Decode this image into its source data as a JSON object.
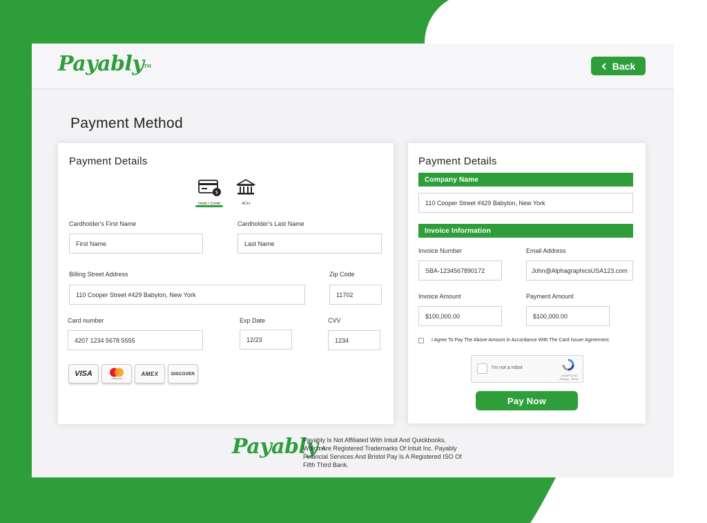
{
  "header": {
    "logo_text": "Payably",
    "logo_tm": "TM",
    "back_label": "Back"
  },
  "page_title": "Payment Method",
  "left_card": {
    "title": "Payment Details",
    "methods": [
      {
        "label": "Debit / Credit",
        "icon": "credit-card-icon",
        "selected": true
      },
      {
        "label": "ACH",
        "icon": "bank-icon",
        "selected": false
      }
    ],
    "fields": {
      "first_name": {
        "label": "Cardholder's First Name",
        "value": "First Name"
      },
      "last_name": {
        "label": "Cardholder's  Last Name",
        "value": "Last Name"
      },
      "street": {
        "label": "Billing Street Address",
        "value": "110 Cooper Street #429 Babylon, New York"
      },
      "zip": {
        "label": "Zip Code",
        "value": "11702"
      },
      "card_number": {
        "label": "Card number",
        "value": "4207 1234 5678 5555"
      },
      "exp_date": {
        "label": "Exp Date",
        "value": "12/23"
      },
      "cvv": {
        "label": "CVV",
        "value": "1234"
      }
    },
    "card_brands": [
      "VISA",
      "mastercard",
      "AMEX",
      "DISCOVER"
    ]
  },
  "right_card": {
    "title": "Payment Details",
    "company_section": "Company Name",
    "company_address": "110 Cooper Street #429 Babylon, New York",
    "invoice_section": "Invoice Information",
    "invoice_number": {
      "label": "Invoice Number",
      "value": "SBA-1234567890172"
    },
    "email": {
      "label": "Email Address",
      "value": "John@AlphagraphicsUSA123.com"
    },
    "invoice_amount": {
      "label": "Invoice Amount",
      "value": "$100,000.00"
    },
    "payment_amount": {
      "label": "Payment Amount",
      "value": "$100,000.00"
    },
    "agreement": "I Agree To Pay The Above Amount In Accordance With The Card Issuer Agreement.",
    "recaptcha": {
      "text": "I'm not a robot",
      "brand": "reCAPTCHA",
      "links": "Privacy - Terms"
    },
    "pay_label": "Pay Now"
  },
  "footer": {
    "logo_text": "Payably",
    "logo_tm": "TM",
    "disclaimer_lines": [
      "Payably Is Not Affiliated With Intuit And Quickbooks,",
      "Which Are Registered Trademarks Of Intuit Inc. Payably",
      "Financial Services And Bristol Pay Is A Registered ISO Of",
      "Fifth Third Bank."
    ]
  },
  "colors": {
    "brand_green": "#2e9e3a",
    "frame_bg": "#f3f3f5"
  }
}
